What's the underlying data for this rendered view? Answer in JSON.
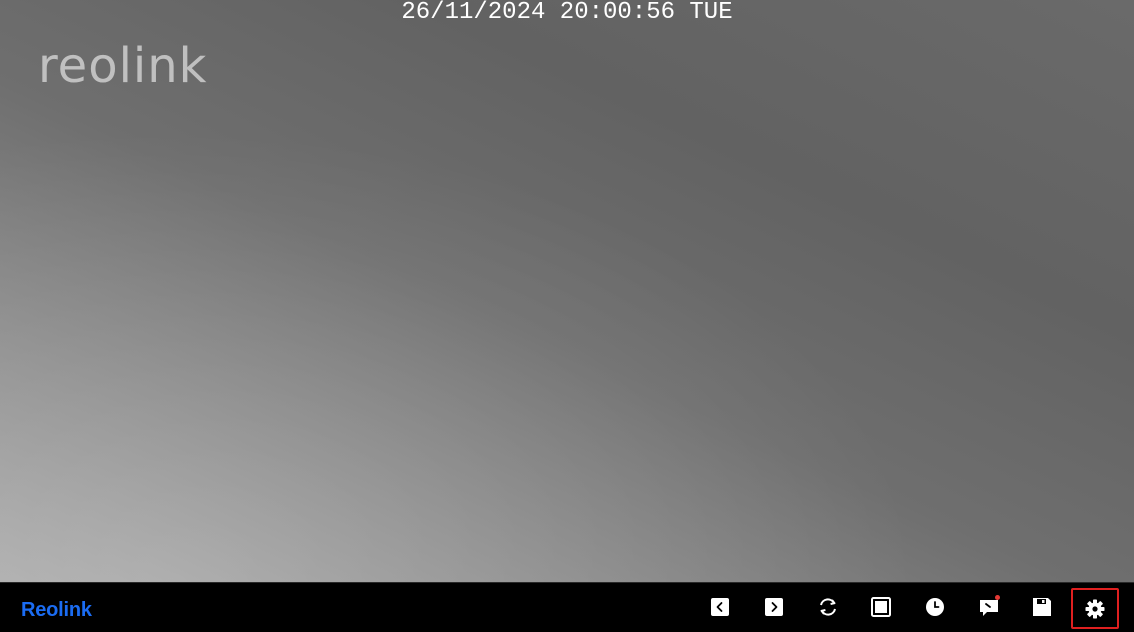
{
  "osd": {
    "timestamp": "26/11/2024 20:00:56 TUE",
    "watermark": "reolink"
  },
  "toolbar": {
    "brand": "Reolink",
    "buttons": [
      {
        "name": "prev-icon"
      },
      {
        "name": "next-icon"
      },
      {
        "name": "refresh-icon"
      },
      {
        "name": "fullscreen-icon"
      },
      {
        "name": "clock-icon"
      },
      {
        "name": "notification-icon",
        "badge": true
      },
      {
        "name": "save-icon"
      },
      {
        "name": "gear-icon",
        "highlighted": true
      }
    ]
  },
  "colors": {
    "brand": "#1b6cf2",
    "highlight": "#e02020",
    "badge": "#e53935",
    "icon": "#ffffff"
  }
}
